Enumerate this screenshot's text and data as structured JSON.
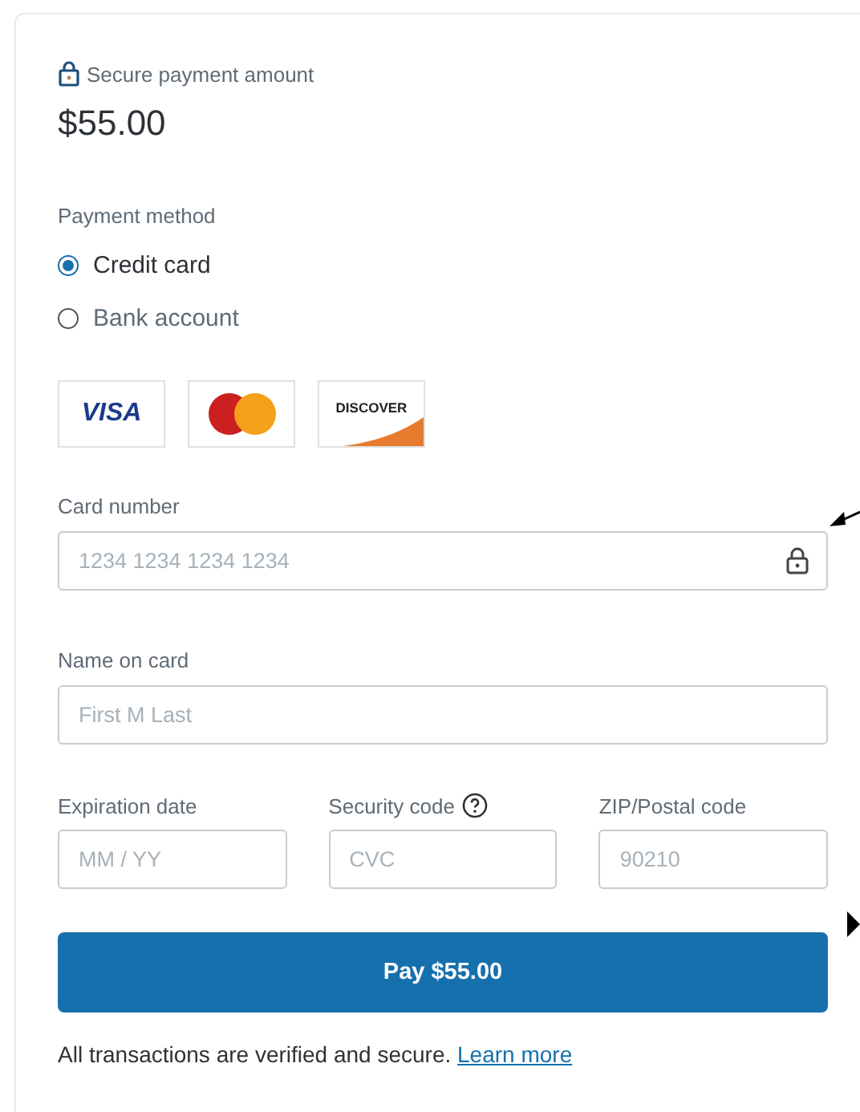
{
  "amount_header": {
    "label": "Secure payment amount",
    "amount": "$55.00"
  },
  "payment_method": {
    "label": "Payment method",
    "options": [
      {
        "label": "Credit card",
        "selected": true
      },
      {
        "label": "Bank account",
        "selected": false
      }
    ]
  },
  "card_logos": [
    {
      "kind": "visa",
      "label": "VISA"
    },
    {
      "kind": "mastercard"
    },
    {
      "kind": "discover",
      "label": "DISCOVER"
    }
  ],
  "fields": {
    "card_number": {
      "label": "Card number",
      "placeholder": "1234 1234 1234 1234"
    },
    "name_on_card": {
      "label": "Name on card",
      "placeholder": "First M Last"
    },
    "row": [
      {
        "label": "Expiration date",
        "placeholder": "MM / YY",
        "help": false
      },
      {
        "label": "Security code",
        "placeholder": "CVC",
        "help": true
      },
      {
        "label": "ZIP/Postal code",
        "placeholder": "90210",
        "help": false
      }
    ]
  },
  "pay_button": "Pay $55.00",
  "footer": {
    "text": "All transactions are verified and secure.",
    "link": "Learn more"
  }
}
